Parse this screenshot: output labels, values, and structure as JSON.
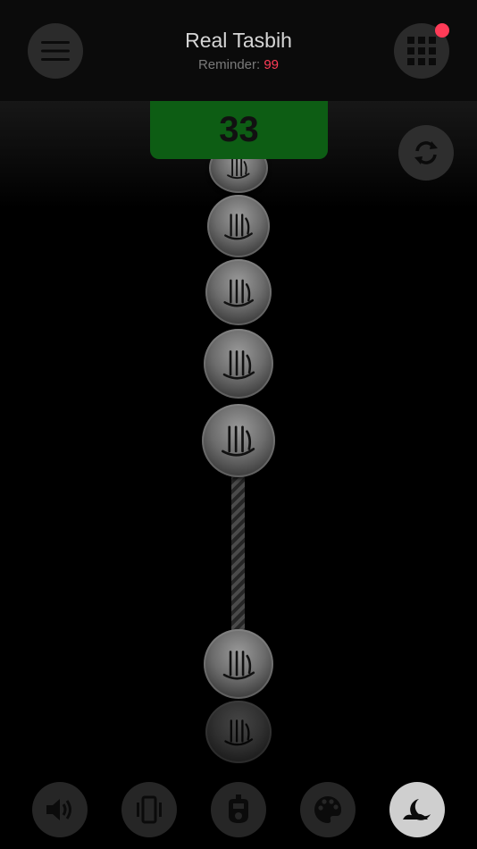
{
  "app": {
    "title": "Real Tasbih",
    "reminder_label": "Reminder:",
    "reminder_value": "99"
  },
  "counter": {
    "value": "33"
  },
  "colors": {
    "accent_red": "#ff3b57",
    "counter_green": "#0d5d14",
    "button_gray": "#2b2b2b",
    "active_button": "#cfcfcf"
  },
  "icons": {
    "menu": "hamburger-menu-icon",
    "grid": "grid-apps-icon",
    "reset": "sync-reset-icon",
    "bead_glyph": "allah-calligraphy-icon"
  },
  "toolbar": {
    "items": [
      {
        "name": "sound",
        "icon": "speaker-icon",
        "active": false
      },
      {
        "name": "vibration",
        "icon": "vibration-icon",
        "active": false
      },
      {
        "name": "counter-device",
        "icon": "tally-counter-icon",
        "active": false
      },
      {
        "name": "theme",
        "icon": "palette-icon",
        "active": false
      },
      {
        "name": "night-mode",
        "icon": "moon-icon",
        "active": true
      }
    ]
  }
}
